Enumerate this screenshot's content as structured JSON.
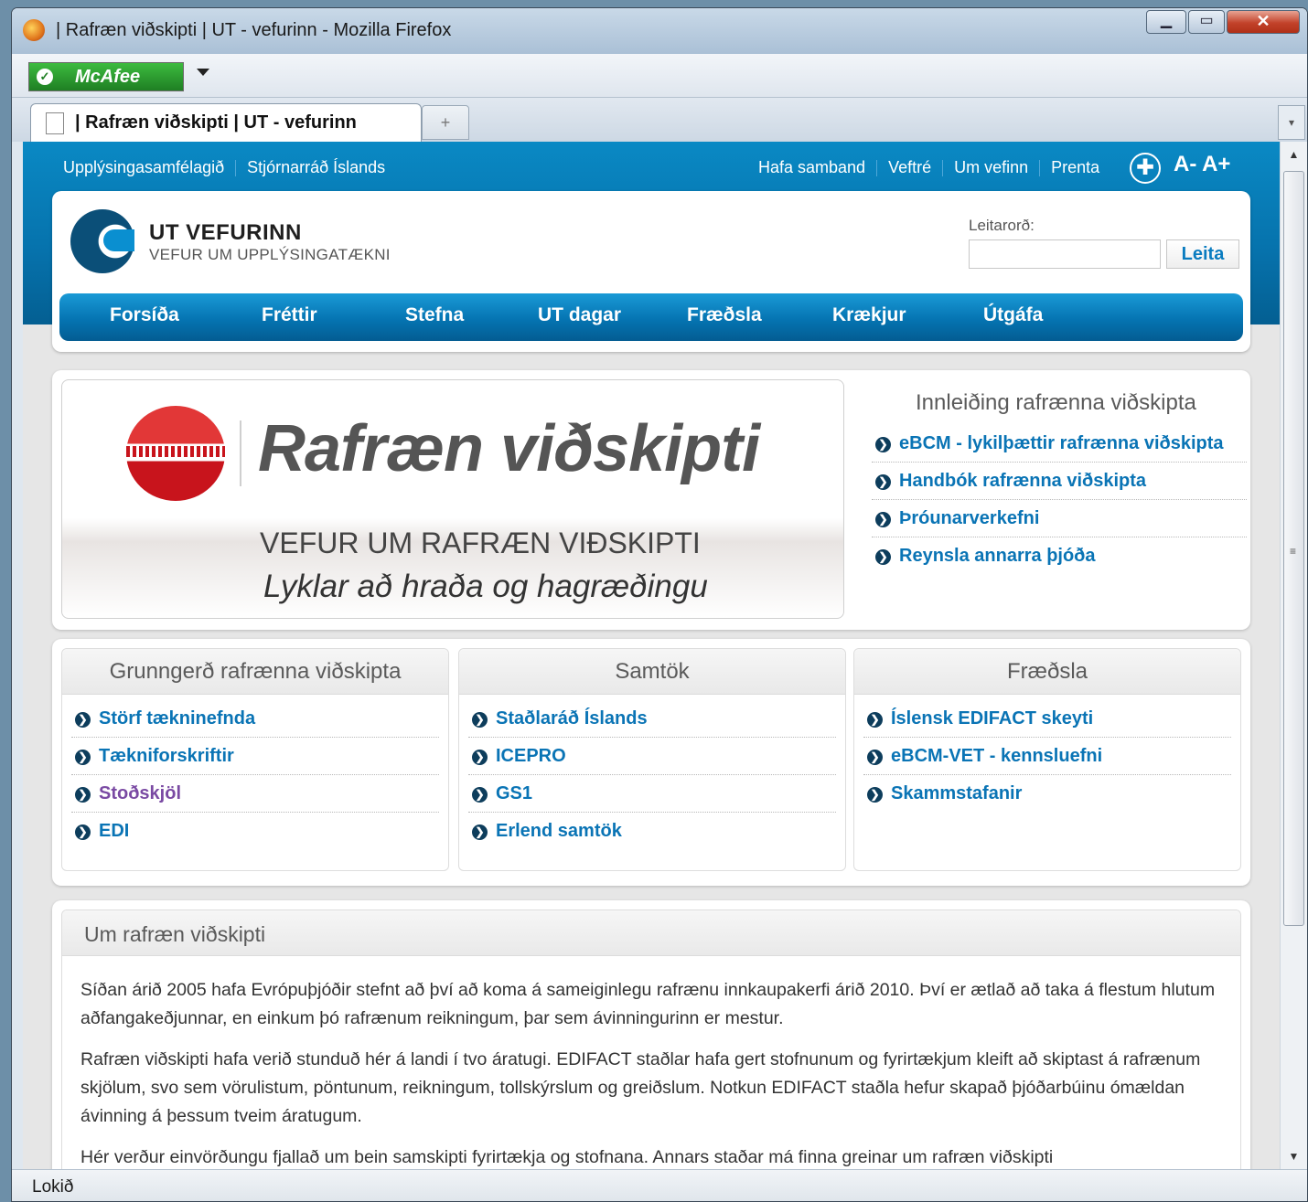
{
  "browser": {
    "window_title": "| Rafræn viðskipti | UT - vefurinn - Mozilla Firefox",
    "tab_title": "| Rafræn viðskipti | UT - vefurinn",
    "addon": "McAfee",
    "status": "Lokið",
    "icons": {
      "app": "firefox-icon",
      "minimize": "minimize-icon",
      "maximize": "maximize-icon",
      "close": "close-icon"
    }
  },
  "site": {
    "util_nav": [
      "Upplýsingasamfélagið",
      "Stjórnarráð Íslands"
    ],
    "right_nav": [
      "Hafa samband",
      "Veftré",
      "Um vefinn",
      "Prenta"
    ],
    "font_controls": "A- A+",
    "logo_title": "UT VEFURINN",
    "logo_subtitle": "VEFUR UM UPPLÝSINGATÆKNI",
    "search": {
      "label": "Leitarorð:",
      "value": "",
      "button": "Leita"
    },
    "main_nav": [
      "Forsíða",
      "Fréttir",
      "Stefna",
      "UT dagar",
      "Fræðsla",
      "Krækjur",
      "Útgáfa"
    ]
  },
  "banner": {
    "title": "Rafræn viðskipti",
    "subtitle": "VEFUR UM RAFRÆN VIÐSKIPTI",
    "tagline": "Lyklar að  hraða og hagræðingu"
  },
  "intro": {
    "title": "Innleiðing rafrænna viðskipta",
    "links": [
      "eBCM - lykilþættir rafrænna viðskipta",
      "Handbók rafrænna viðskipta",
      "Þróunarverkefni",
      "Reynsla annarra þjóða"
    ]
  },
  "boxes": [
    {
      "title": "Grunngerð rafrænna viðskipta",
      "links": [
        "Störf tækninefnda",
        "Tækniforskriftir",
        "Stoðskjöl",
        "EDI"
      ]
    },
    {
      "title": "Samtök",
      "links": [
        "Staðlaráð Íslands",
        "ICEPRO",
        "GS1",
        "Erlend samtök"
      ]
    },
    {
      "title": "Fræðsla",
      "links": [
        "Íslensk EDIFACT skeyti",
        "eBCM-VET - kennsluefni",
        "Skammstafanir"
      ]
    }
  ],
  "about": {
    "title": "Um rafræn viðskipti",
    "paragraphs": [
      "Síðan árið 2005 hafa Evrópuþjóðir stefnt að því að koma á sameiginlegu rafrænu innkaupakerfi árið 2010. Því er ætlað að taka á flestum hlutum aðfangakeðjunnar, en einkum þó rafrænum reikningum, þar sem ávinningurinn er mestur.",
      "Rafræn viðskipti hafa verið stunduð hér á landi í tvo áratugi. EDIFACT staðlar hafa gert stofnunum og fyrirtækjum kleift að skiptast á rafrænum skjölum, svo sem vörulistum, pöntunum, reikningum, tollskýrslum og greiðslum. Notkun EDIFACT staðla hefur skapað þjóðarbúinu ómældan ávinning á þessum tveim áratugum.",
      "Hér verður einvörðungu fjallað um bein samskipti fyrirtækja og stofnana. Annars staðar má finna greinar um rafræn viðskipti"
    ]
  }
}
